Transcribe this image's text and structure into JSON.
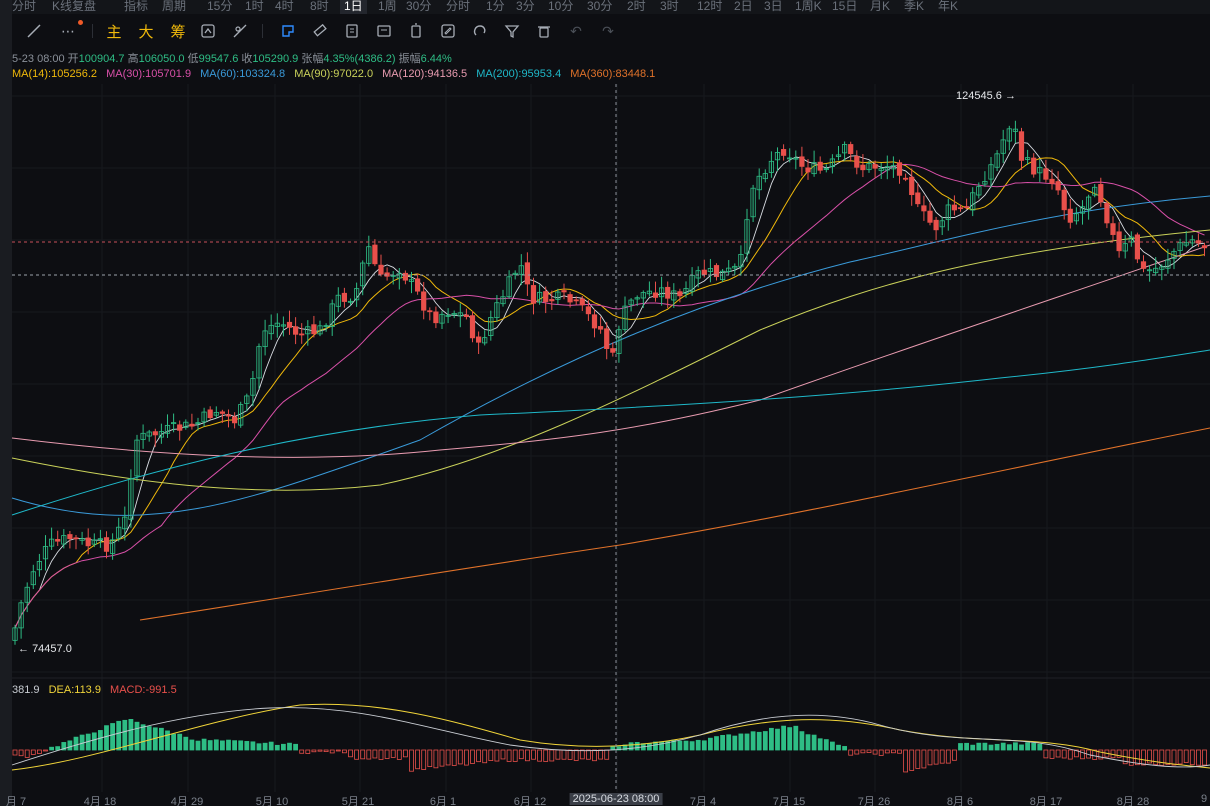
{
  "topbar": {
    "timeframes": [
      "分时",
      "K线复盘",
      "指标",
      "周期",
      "15分",
      "1时",
      "4时",
      "8时",
      "1日",
      "1周",
      "30分",
      "分时",
      "1分",
      "3分",
      "10分",
      "30分",
      "2时",
      "3时",
      "12时",
      "2日",
      "3日",
      "1周K",
      "15日",
      "月K",
      "季K",
      "年K"
    ],
    "active": "1日"
  },
  "toolbar": {
    "cn_main": "主",
    "cn_big": "大",
    "cn_chip": "筹"
  },
  "ohlc": {
    "date": "5-23 08:00",
    "open_label": "开",
    "open": "100904.7",
    "high_label": "高",
    "high": "106050.0",
    "low_label": "低",
    "low": "99547.6",
    "close_label": "收",
    "close": "105290.9",
    "chg_label": "张幅",
    "chg": "4.35%(4386.2)",
    "amp_label": "振幅",
    "amp": "6.44%"
  },
  "ma": [
    {
      "label": "MA(14):105256.2",
      "color": "#f0b90b"
    },
    {
      "label": "MA(30):105701.9",
      "color": "#d850a8"
    },
    {
      "label": "MA(60):103324.8",
      "color": "#3a9ad9"
    },
    {
      "label": "MA(90):97022.0",
      "color": "#c9d15a"
    },
    {
      "label": "MA(120):94136.5",
      "color": "#e89bb0"
    },
    {
      "label": "MA(200):95953.4",
      "color": "#1fb8c9"
    },
    {
      "label": "MA(360):83448.1",
      "color": "#e0722a"
    }
  ],
  "macd_info": {
    "dif": "381.9",
    "dea": "DEA:113.9",
    "macd": "MACD:-991.5",
    "dea_color": "#f0d43a",
    "macd_color": "#e8504b"
  },
  "price_marks": {
    "high": "124545.6",
    "low": "74457.0"
  },
  "xaxis": {
    "labels": [
      "月 7",
      "4月 18",
      "4月 29",
      "5月 10",
      "5月 21",
      "6月 1",
      "6月 12",
      "2025-06-23 08:00",
      "7月 4",
      "7月 15",
      "7月 26",
      "8月 6",
      "8月 17",
      "8月 28",
      "9"
    ],
    "crosshair_date": "2025-06-23 08:00"
  },
  "colors": {
    "up": "#2ebd85",
    "down": "#e8504b",
    "background": "#0d0e12",
    "accent": "#2e8bff"
  }
}
